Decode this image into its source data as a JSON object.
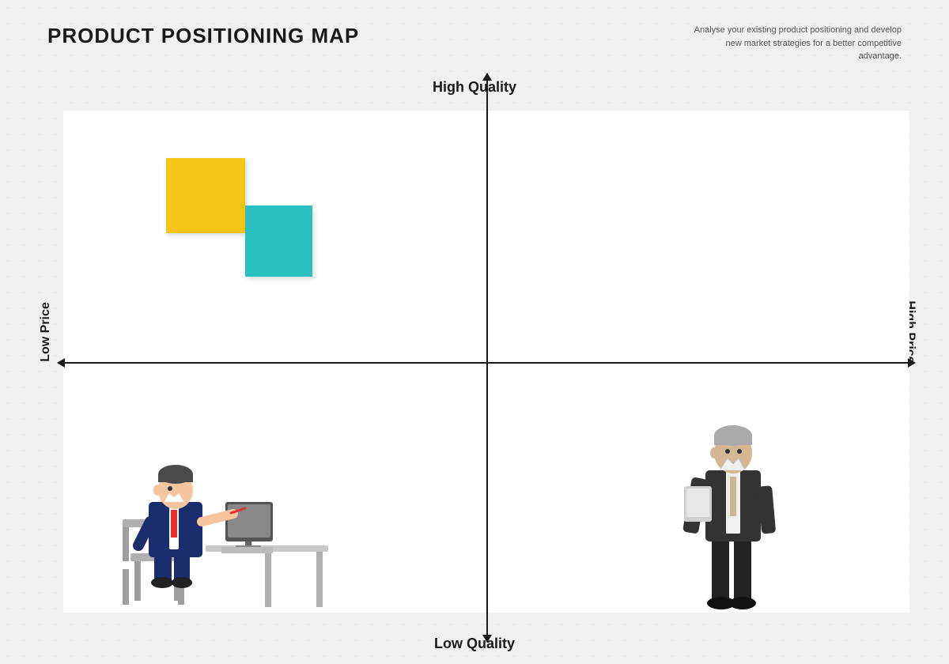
{
  "page": {
    "title": "PRODUCT POSITIONING MAP",
    "subtitle": "Analyse your existing product positioning and develop new market strategies for a better competitive advantage.",
    "axis": {
      "top": "High Quality",
      "bottom": "Low Quality",
      "left": "Low Price",
      "right": "High Price"
    },
    "sticky_notes": [
      {
        "color": "#f5c518",
        "label": "yellow-sticky"
      },
      {
        "color": "#2cbfbf",
        "label": "teal-sticky"
      }
    ]
  }
}
